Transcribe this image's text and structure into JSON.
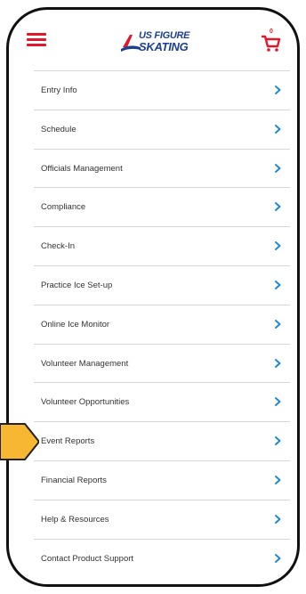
{
  "header": {
    "logo_line1": "US FIGURE",
    "logo_line2": "SKATING",
    "cart_count": "0"
  },
  "menu": {
    "items": [
      {
        "label": "Entry Info"
      },
      {
        "label": "Schedule"
      },
      {
        "label": "Officials Management"
      },
      {
        "label": "Compliance"
      },
      {
        "label": "Check-In"
      },
      {
        "label": "Practice Ice Set-up"
      },
      {
        "label": "Online Ice Monitor"
      },
      {
        "label": "Volunteer Management"
      },
      {
        "label": "Volunteer Opportunities"
      },
      {
        "label": "Event Reports"
      },
      {
        "label": "Financial Reports"
      },
      {
        "label": "Help & Resources"
      },
      {
        "label": "Contact Product Support"
      }
    ]
  },
  "colors": {
    "accent_red": "#e3172b",
    "brand_blue": "#1d3f8f",
    "chevron_blue": "#1e88d9",
    "pointer_yellow": "#f7b733"
  },
  "icons": [
    "hamburger-menu-icon",
    "cart-icon",
    "chevron-right-icon",
    "pointer-arrow-icon"
  ]
}
